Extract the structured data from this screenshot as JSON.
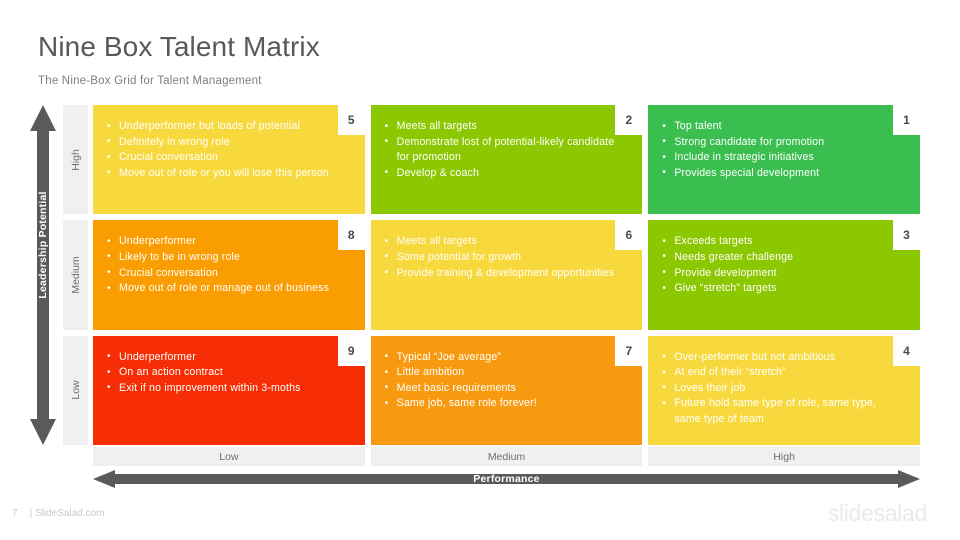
{
  "header": {
    "title": "Nine Box Talent Matrix",
    "subtitle": "The Nine-Box Grid for Talent Management"
  },
  "axes": {
    "y_label": "Leadership Potential",
    "y_tiers": [
      "High",
      "Medium",
      "Low"
    ],
    "x_label": "Performance",
    "x_tiers": [
      "Low",
      "Medium",
      "High"
    ],
    "arrow_color": "#5a5a5a"
  },
  "cells": [
    {
      "number": "5",
      "color": "#F7D93D",
      "bullets": [
        "Underperformer  but loads of potential",
        "Definitely  in wrong role",
        "Crucial  conversation",
        "Move out of role or you will lose this person"
      ]
    },
    {
      "number": "2",
      "color": "#8CC801",
      "bullets": [
        "Meets all targets",
        "Demonstrate  lost of potential-likely candidate  for promotion",
        "Develop & coach"
      ]
    },
    {
      "number": "1",
      "color": "#39BE4F",
      "bullets": [
        "Top talent",
        "Strong candidate  for promotion",
        "Include  in strategic initiatives",
        "Provides  special development"
      ]
    },
    {
      "number": "8",
      "color": "#FA9D00",
      "bullets": [
        "Underperformer",
        "Likely  to be in wrong  role",
        "Crucial  conversation",
        "Move out of role or manage out of business"
      ]
    },
    {
      "number": "6",
      "color": "#F7D93D",
      "bullets": [
        "Meets all targets",
        "Some potential  for growth",
        "Provide  training & development opportunities"
      ]
    },
    {
      "number": "3",
      "color": "#8CC801",
      "bullets": [
        "Exceeds targets",
        "Needs greater challenge",
        "Provide  development",
        "Give “stretch” targets"
      ]
    },
    {
      "number": "9",
      "color": "#F62D05",
      "bullets": [
        "Underperformer",
        "On an action contract",
        "Exit if no improvement  within 3-moths"
      ]
    },
    {
      "number": "7",
      "color": "#F89A10",
      "bullets": [
        "Typical “Joe average”",
        "Little ambition",
        "Meet basic requirements",
        "Same job, same role forever!"
      ]
    },
    {
      "number": "4",
      "color": "#F7D93D",
      "bullets": [
        "Over-performer  but not ambitious",
        "At end of their “stretch”",
        "Loves their job",
        "Future hold same type of role, same type, same type of team"
      ]
    }
  ],
  "footer": {
    "page_number": "7",
    "source": "| SlideSalad.com",
    "logo": "slidesalad"
  }
}
